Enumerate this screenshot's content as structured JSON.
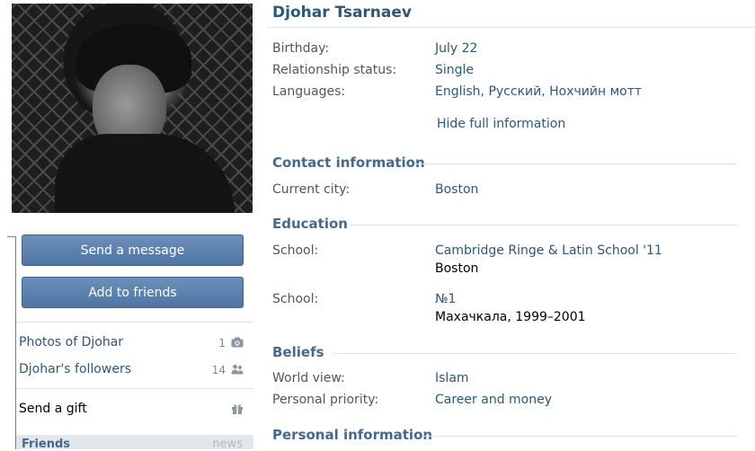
{
  "profile": {
    "name": "Djohar Tsarnaev",
    "buttons": {
      "message": "Send a message",
      "add_friend": "Add to friends"
    },
    "menu": [
      {
        "label": "Photos of Djohar",
        "count": "1",
        "icon": "camera-icon"
      },
      {
        "label": "Djohar's followers",
        "count": "14",
        "icon": "people-icon"
      },
      {
        "label": "Send a gift",
        "count": "",
        "icon": "gift-icon"
      }
    ],
    "friends": {
      "label": "Friends",
      "note": "news"
    }
  },
  "info": {
    "birthday": {
      "label": "Birthday:",
      "value": "July 22"
    },
    "relationship": {
      "label": "Relationship status:",
      "value": "Single"
    },
    "languages": {
      "label": "Languages:",
      "value": "English, Русский, Нохчийн мотт"
    },
    "hide_link": "Hide full information"
  },
  "contact": {
    "heading": "Contact information",
    "city": {
      "label": "Current city:",
      "value": "Boston"
    }
  },
  "education": {
    "heading": "Education",
    "school1": {
      "label": "School:",
      "value": "Cambridge Ringe & Latin School '11",
      "sub": "Boston"
    },
    "school2": {
      "label": "School:",
      "value": "№1",
      "sub": "Махачкала, 1999–2001"
    }
  },
  "beliefs": {
    "heading": "Beliefs",
    "worldview": {
      "label": "World view:",
      "value": "Islam"
    },
    "priority": {
      "label": "Personal priority:",
      "value": "Career and money"
    }
  },
  "personal": {
    "heading": "Personal information"
  },
  "colors": {
    "link": "#2b587a",
    "heading": "#45688e",
    "button": "#5a7fac"
  }
}
